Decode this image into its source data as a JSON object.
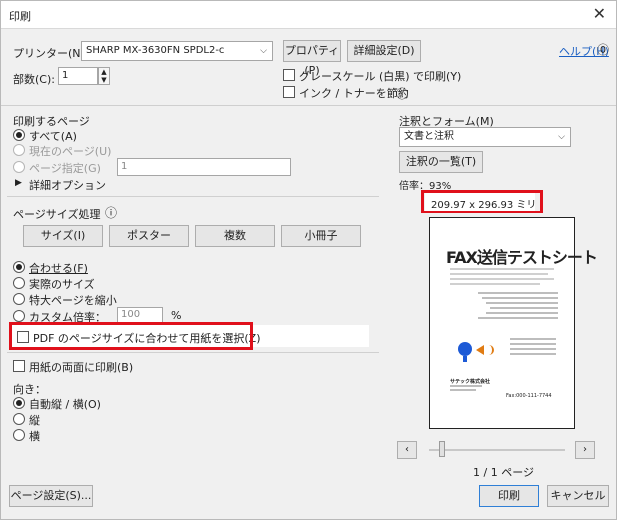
{
  "window": {
    "title": "印刷"
  },
  "top": {
    "printer_label": "プリンター(N):",
    "printer_value": "SHARP MX-3630FN SPDL2-c",
    "properties_btn": "プロパティ(P)",
    "advanced_btn": "詳細設定(D)",
    "help_link": "ヘルプ(H)",
    "copies_label": "部数(C):",
    "copies_value": "1",
    "grayscale_label": "グレースケール (白黒) で印刷(Y)",
    "save_ink_label": "インク / トナーを節約",
    "info_icon_text": "ⓘ"
  },
  "pages": {
    "heading": "印刷するページ",
    "all": "すべて(A)",
    "current": "現在のページ(U)",
    "specify": "ページ指定(G)",
    "specify_value": "1",
    "more_options": "詳細オプション"
  },
  "sizing": {
    "heading": "ページサイズ処理",
    "tabs": [
      "サイズ(I)",
      "ポスター",
      "複数",
      "小冊子"
    ],
    "fit": "合わせる(F)",
    "actual": "実際のサイズ",
    "shrink": "特大ページを縮小",
    "custom": "カスタム倍率：",
    "custom_value": "100",
    "percent": "%",
    "choose_paper": "PDF のページサイズに合わせて用紙を選択(Z)",
    "duplex": "用紙の両面に印刷(B)"
  },
  "orientation": {
    "heading": "向き：",
    "auto": "自動縦 / 横(O)",
    "portrait": "縦",
    "landscape": "横"
  },
  "comments": {
    "heading": "注釈とフォーム(M)",
    "select_value": "文書と注釈",
    "summary_btn": "注釈の一覧(T)"
  },
  "preview": {
    "scale_label": "倍率：93%",
    "size_label": "209.97 x 296.93 ミリ",
    "doc_title": "FAX送信テストシート",
    "doc_company": "サテック株式会社",
    "doc_fax": "Fax:000-111-7744",
    "page_indicator": "1 / 1 ページ"
  },
  "bottom": {
    "page_setup_btn": "ページ設定(S)...",
    "print_btn": "印刷",
    "cancel_btn": "キャンセル"
  },
  "colors": {
    "highlight": "#e0101b",
    "link": "#1b5fc2",
    "primary_border": "#2f7fd6"
  }
}
